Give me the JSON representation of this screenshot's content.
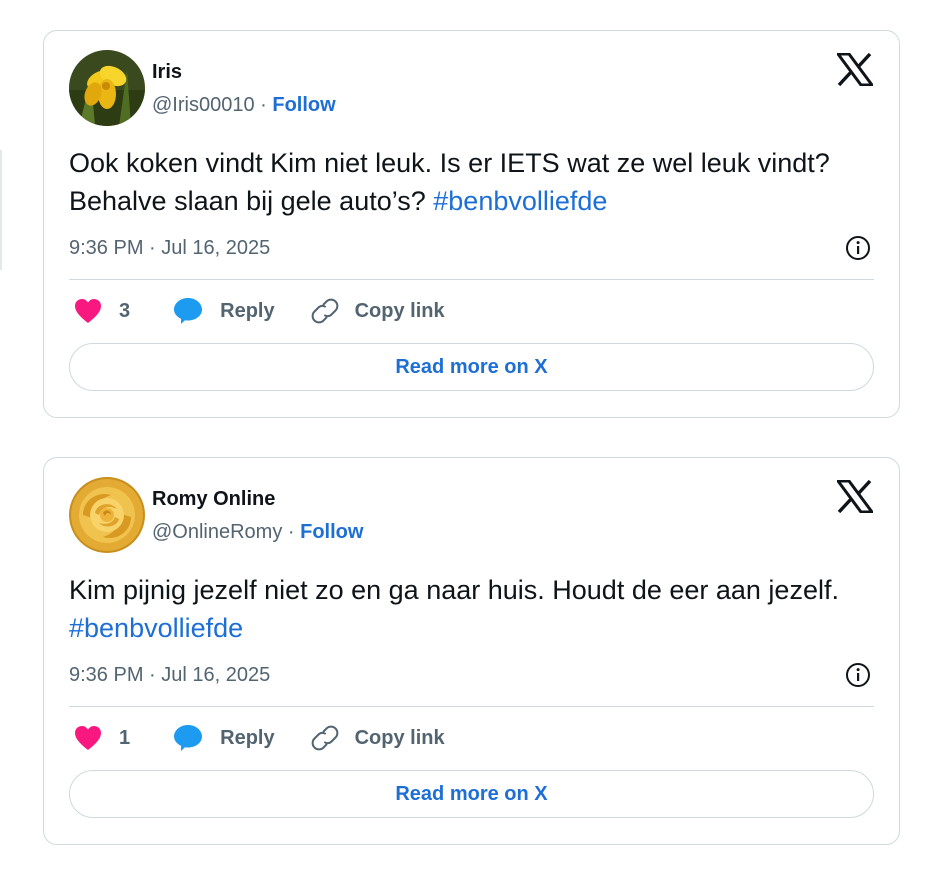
{
  "tweets": [
    {
      "author_name": "Iris",
      "handle": "@Iris00010",
      "separator": " · ",
      "follow_label": "Follow",
      "text": "Ook koken vindt Kim niet leuk. Is er IETS wat ze wel leuk vindt? Behalve slaan bij gele auto’s? ",
      "hashtag": "#benbvolliefde",
      "timestamp": "9:36 PM · Jul 16, 2025",
      "like_count": "3",
      "reply_label": "Reply",
      "copy_label": "Copy link",
      "read_more_label": "Read more on X",
      "avatar": "yellow-iris-flower"
    },
    {
      "author_name": "Romy Online",
      "handle": "@OnlineRomy",
      "separator": " · ",
      "follow_label": "Follow",
      "text": "Kim pijnig jezelf niet zo en ga naar huis. Houdt de eer aan jezelf. ",
      "hashtag": "#benbvolliefde",
      "timestamp": "9:36 PM · Jul 16, 2025",
      "like_count": "1",
      "reply_label": "Reply",
      "copy_label": "Copy link",
      "read_more_label": "Read more on X",
      "avatar": "yellow-rose"
    }
  ],
  "colors": {
    "link_blue": "#1d6fd6",
    "heart_pink": "#f91880",
    "reply_blue": "#1d9bf0",
    "muted_text": "#536471",
    "border": "#cfd9de"
  },
  "icons": [
    "x-logo-icon",
    "info-icon",
    "heart-icon",
    "reply-bubble-icon",
    "link-icon"
  ]
}
